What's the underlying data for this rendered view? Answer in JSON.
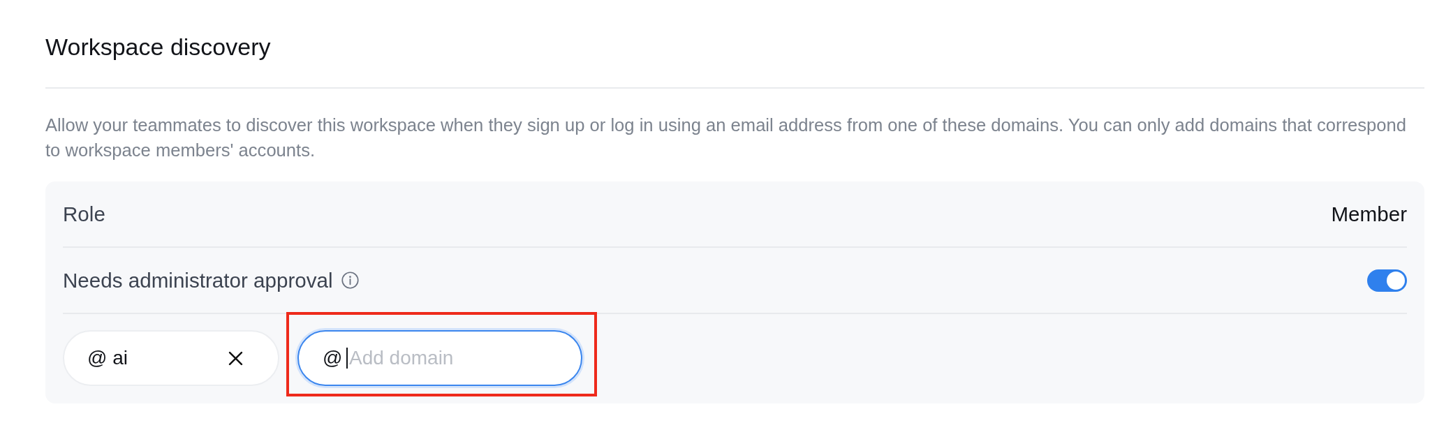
{
  "section": {
    "title": "Workspace discovery",
    "description": "Allow your teammates to discover this workspace when they sign up or log in using an email address from one of these domains. You can only add domains that correspond to workspace members' accounts."
  },
  "settings": [
    {
      "kind": "value",
      "label": "Role",
      "value": "Member"
    },
    {
      "kind": "toggle",
      "label": "Needs administrator approval",
      "info": true,
      "on": true
    }
  ],
  "domains": [
    {
      "label": "@ ai"
    }
  ],
  "domain_input": {
    "prefix": "@",
    "placeholder": "Add domain",
    "focused": true,
    "highlighted": true
  }
}
